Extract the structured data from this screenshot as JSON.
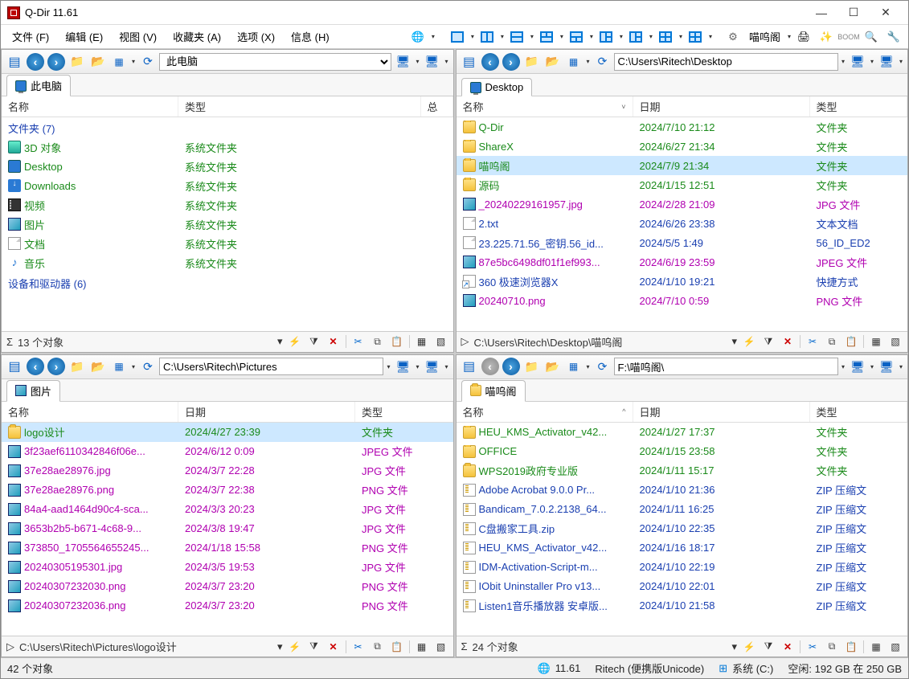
{
  "window": {
    "title": "Q-Dir 11.61"
  },
  "menu": {
    "file": "文件 (F)",
    "edit": "编辑 (E)",
    "view": "视图 (V)",
    "favorites": "收藏夹 (A)",
    "options": "选项 (X)",
    "info": "信息 (H)",
    "fav_label": "喵呜阁"
  },
  "panes": {
    "tl": {
      "address": "此电脑",
      "tab": "此电脑",
      "cols": {
        "name": "名称",
        "type": "类型",
        "extra": "总"
      },
      "groups": {
        "folders": "文件夹 (7)",
        "devices": "设备和驱动器 (6)"
      },
      "rows": [
        {
          "icon": "3d",
          "name": "3D 对象",
          "type": "系统文件夹",
          "cls": "green"
        },
        {
          "icon": "pc",
          "name": "Desktop",
          "type": "系统文件夹",
          "cls": "green"
        },
        {
          "icon": "down",
          "name": "Downloads",
          "type": "系统文件夹",
          "cls": "green"
        },
        {
          "icon": "video",
          "name": "视频",
          "type": "系统文件夹",
          "cls": "green"
        },
        {
          "icon": "img",
          "name": "图片",
          "type": "系统文件夹",
          "cls": "green"
        },
        {
          "icon": "file",
          "name": "文档",
          "type": "系统文件夹",
          "cls": "green"
        },
        {
          "icon": "music",
          "name": "音乐",
          "type": "系统文件夹",
          "cls": "green"
        }
      ],
      "footer": "13 个对象"
    },
    "tr": {
      "address": "C:\\Users\\Ritech\\Desktop",
      "tab": "Desktop",
      "cols": {
        "name": "名称",
        "date": "日期",
        "type": "类型"
      },
      "rows": [
        {
          "icon": "folder",
          "name": "Q-Dir",
          "date": "2024/7/10 21:12",
          "type": "文件夹",
          "cls": "green"
        },
        {
          "icon": "folder",
          "name": "ShareX",
          "date": "2024/6/27 21:34",
          "type": "文件夹",
          "cls": "green"
        },
        {
          "icon": "folder",
          "name": "喵呜阁",
          "date": "2024/7/9 21:34",
          "type": "文件夹",
          "cls": "green",
          "sel": true
        },
        {
          "icon": "folder",
          "name": "源码",
          "date": "2024/1/15 12:51",
          "type": "文件夹",
          "cls": "green"
        },
        {
          "icon": "img",
          "name": "_20240229161957.jpg",
          "date": "2024/2/28 21:09",
          "type": "JPG 文件",
          "cls": "mag"
        },
        {
          "icon": "file",
          "name": "2.txt",
          "date": "2024/6/26 23:38",
          "type": "文本文档",
          "cls": "blue"
        },
        {
          "icon": "file",
          "name": "23.225.71.56_密钥.56_id...",
          "date": "2024/5/5 1:49",
          "type": "56_ID_ED2",
          "cls": "blue"
        },
        {
          "icon": "img",
          "name": "87e5bc6498df01f1ef993...",
          "date": "2024/6/19 23:59",
          "type": "JPEG 文件",
          "cls": "mag"
        },
        {
          "icon": "link",
          "name": "360 极速浏览器X",
          "date": "2024/1/10 19:21",
          "type": "快捷方式",
          "cls": "blue"
        },
        {
          "icon": "img",
          "name": "20240710.png",
          "date": "2024/7/10 0:59",
          "type": "PNG 文件",
          "cls": "mag"
        }
      ],
      "footer": "C:\\Users\\Ritech\\Desktop\\喵呜阁"
    },
    "bl": {
      "address": "C:\\Users\\Ritech\\Pictures",
      "tab": "图片",
      "cols": {
        "name": "名称",
        "date": "日期",
        "type": "类型"
      },
      "rows": [
        {
          "icon": "folder",
          "name": "logo设计",
          "date": "2024/4/27 23:39",
          "type": "文件夹",
          "cls": "green",
          "sel": true
        },
        {
          "icon": "img",
          "name": "3f23aef6110342846f06e...",
          "date": "2024/6/12 0:09",
          "type": "JPEG 文件",
          "cls": "mag"
        },
        {
          "icon": "img",
          "name": "37e28ae28976.jpg",
          "date": "2024/3/7 22:28",
          "type": "JPG 文件",
          "cls": "mag"
        },
        {
          "icon": "img",
          "name": "37e28ae28976.png",
          "date": "2024/3/7 22:38",
          "type": "PNG 文件",
          "cls": "mag"
        },
        {
          "icon": "img",
          "name": "84a4-aad1464d90c4-sca...",
          "date": "2024/3/3 20:23",
          "type": "JPG 文件",
          "cls": "mag"
        },
        {
          "icon": "img",
          "name": "3653b2b5-b671-4c68-9...",
          "date": "2024/3/8 19:47",
          "type": "JPG 文件",
          "cls": "mag"
        },
        {
          "icon": "img",
          "name": "373850_1705564655245...",
          "date": "2024/1/18 15:58",
          "type": "PNG 文件",
          "cls": "mag"
        },
        {
          "icon": "img",
          "name": "20240305195301.jpg",
          "date": "2024/3/5 19:53",
          "type": "JPG 文件",
          "cls": "mag"
        },
        {
          "icon": "img",
          "name": "20240307232030.png",
          "date": "2024/3/7 23:20",
          "type": "PNG 文件",
          "cls": "mag"
        },
        {
          "icon": "img",
          "name": "20240307232036.png",
          "date": "2024/3/7 23:20",
          "type": "PNG 文件",
          "cls": "mag"
        }
      ],
      "footer": "C:\\Users\\Ritech\\Pictures\\logo设计"
    },
    "br": {
      "address": "F:\\喵呜阁\\",
      "tab": "喵呜阁",
      "cols": {
        "name": "名称",
        "date": "日期",
        "type": "类型"
      },
      "rows": [
        {
          "icon": "folder",
          "name": "HEU_KMS_Activator_v42...",
          "date": "2024/1/27 17:37",
          "type": "文件夹",
          "cls": "green"
        },
        {
          "icon": "folder",
          "name": "OFFICE",
          "date": "2024/1/15 23:58",
          "type": "文件夹",
          "cls": "green"
        },
        {
          "icon": "folder",
          "name": "WPS2019政府专业版",
          "date": "2024/1/11 15:17",
          "type": "文件夹",
          "cls": "green"
        },
        {
          "icon": "zip",
          "name": "Adobe Acrobat 9.0.0 Pr...",
          "date": "2024/1/10 21:36",
          "type": "ZIP 压缩文",
          "cls": "blue"
        },
        {
          "icon": "zip",
          "name": "Bandicam_7.0.2.2138_64...",
          "date": "2024/1/11 16:25",
          "type": "ZIP 压缩文",
          "cls": "blue"
        },
        {
          "icon": "zip",
          "name": "C盘搬家工具.zip",
          "date": "2024/1/10 22:35",
          "type": "ZIP 压缩文",
          "cls": "blue"
        },
        {
          "icon": "zip",
          "name": "HEU_KMS_Activator_v42...",
          "date": "2024/1/16 18:17",
          "type": "ZIP 压缩文",
          "cls": "blue"
        },
        {
          "icon": "zip",
          "name": "IDM-Activation-Script-m...",
          "date": "2024/1/10 22:19",
          "type": "ZIP 压缩文",
          "cls": "blue"
        },
        {
          "icon": "zip",
          "name": "IObit Uninstaller Pro v13...",
          "date": "2024/1/10 22:01",
          "type": "ZIP 压缩文",
          "cls": "blue"
        },
        {
          "icon": "zip",
          "name": "Listen1音乐播放器 安卓版...",
          "date": "2024/1/10 21:58",
          "type": "ZIP 压缩文",
          "cls": "blue"
        }
      ],
      "footer": "24 个对象"
    }
  },
  "status": {
    "objects": "42 个对象",
    "version": "11.61",
    "user": "Ritech (便携版Unicode)",
    "drive": "系统 (C:)",
    "space": "空闲: 192 GB 在 250 GB"
  }
}
